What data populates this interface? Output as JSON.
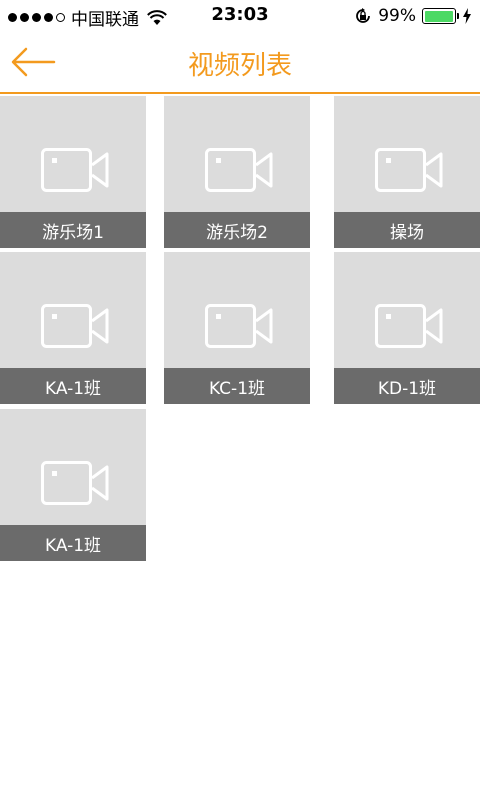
{
  "status_bar": {
    "carrier": "中国联通",
    "time": "23:03",
    "battery_percent": "99%",
    "battery_level": 0.99
  },
  "nav": {
    "title": "视频列表",
    "back_icon": "arrow-left-icon",
    "accent_color": "#f39a1e"
  },
  "videos": [
    {
      "label": "游乐场1",
      "icon": "video-camera-icon"
    },
    {
      "label": "游乐场2",
      "icon": "video-camera-icon"
    },
    {
      "label": "操场",
      "icon": "video-camera-icon"
    },
    {
      "label": "KA-1班",
      "icon": "video-camera-icon"
    },
    {
      "label": "KC-1班",
      "icon": "video-camera-icon"
    },
    {
      "label": "KD-1班",
      "icon": "video-camera-icon"
    },
    {
      "label": "KA-1班",
      "icon": "video-camera-icon"
    }
  ]
}
